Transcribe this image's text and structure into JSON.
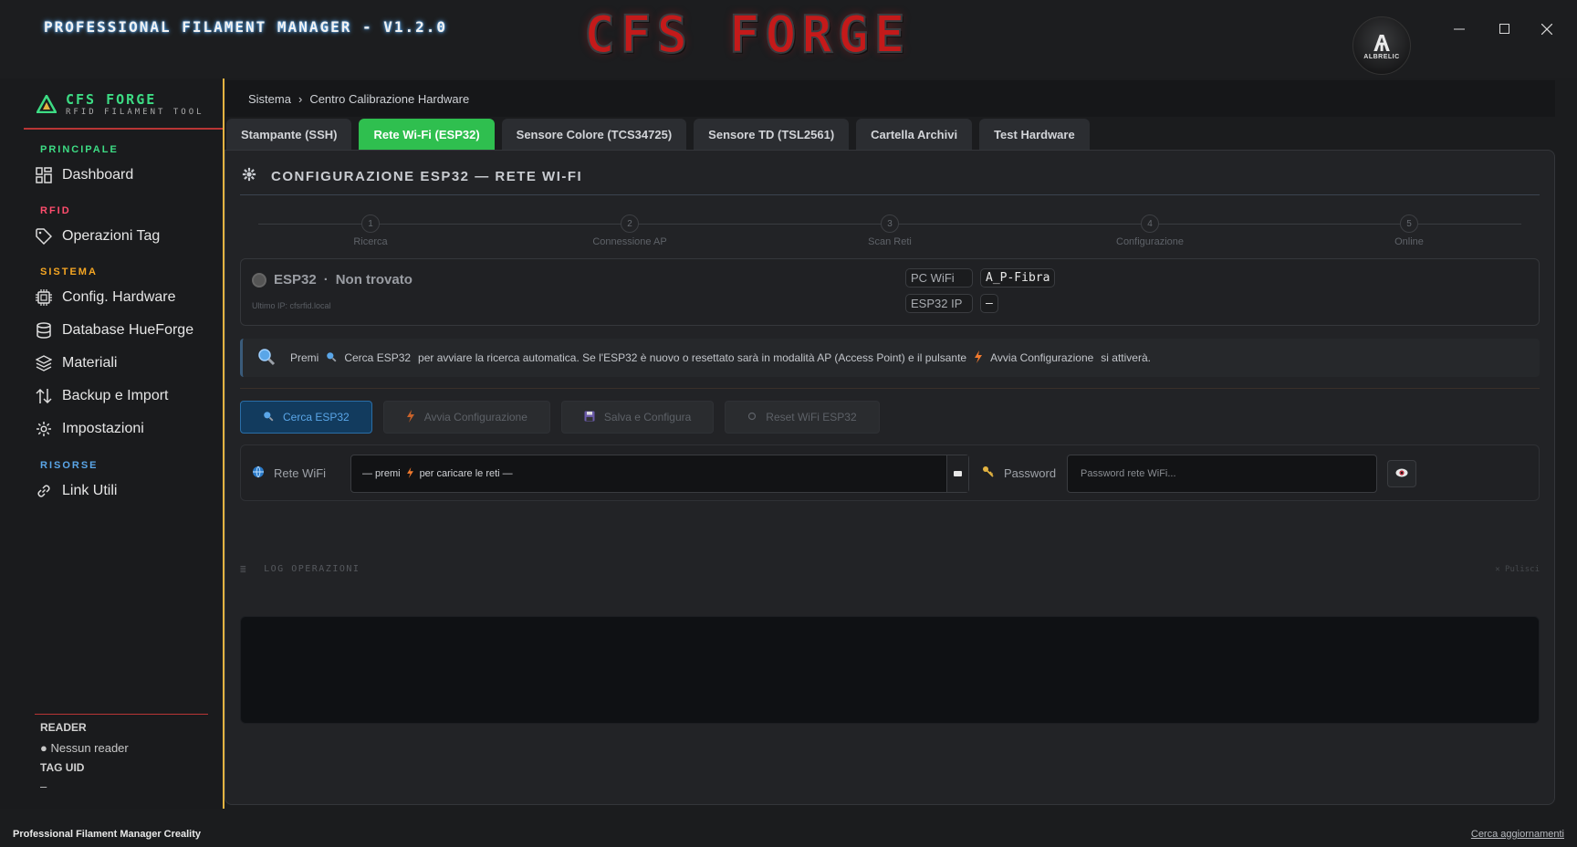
{
  "window": {
    "title": "PROFESSIONAL FILAMENT MANAGER - V1.2.0",
    "brand_logo": "CFS FORGE",
    "avatar_text": "ALBRELIC"
  },
  "sidebar": {
    "brand_name": "CFS FORGE",
    "brand_sub": "RFID FILAMENT TOOL",
    "sections": [
      {
        "label": "PRINCIPALE",
        "color": "#3ddc84"
      },
      {
        "label": "RFID",
        "color": "#ff4d6d"
      },
      {
        "label": "SISTEMA",
        "color": "#f5a623"
      },
      {
        "label": "RISORSE",
        "color": "#5aa6e8"
      }
    ],
    "items": [
      {
        "label": "Dashboard",
        "icon": "grid-icon"
      },
      {
        "label": "Operazioni Tag",
        "icon": "tag-icon"
      },
      {
        "label": "Config. Hardware",
        "icon": "chip-icon"
      },
      {
        "label": "Database HueForge",
        "icon": "database-icon"
      },
      {
        "label": "Materiali",
        "icon": "layers-icon"
      },
      {
        "label": "Backup e Import",
        "icon": "transfer-icon"
      },
      {
        "label": "Impostazioni",
        "icon": "gear-icon"
      },
      {
        "label": "Link Utili",
        "icon": "link-icon"
      }
    ],
    "reader_label": "READER",
    "reader_value": "Nessun reader",
    "tag_uid_label": "TAG UID",
    "tag_uid_value": "–"
  },
  "breadcrumb": {
    "root": "Sistema",
    "separator": "›",
    "current": "Centro Calibrazione Hardware"
  },
  "tabs": [
    {
      "label": "Stampante (SSH)",
      "active": false
    },
    {
      "label": "Rete Wi-Fi (ESP32)",
      "active": true
    },
    {
      "label": "Sensore Colore (TCS34725)",
      "active": false
    },
    {
      "label": "Sensore TD (TSL2561)",
      "active": false
    },
    {
      "label": "Cartella Archivi",
      "active": false
    },
    {
      "label": "Test Hardware",
      "active": false
    }
  ],
  "panel": {
    "title": "CONFIGURAZIONE ESP32 — RETE WI-FI",
    "steps": [
      {
        "num": "1",
        "label": "Ricerca"
      },
      {
        "num": "2",
        "label": "Connessione AP"
      },
      {
        "num": "3",
        "label": "Scan Reti"
      },
      {
        "num": "4",
        "label": "Configurazione"
      },
      {
        "num": "5",
        "label": "Online"
      }
    ],
    "esp_name": "ESP32",
    "esp_dot": "·",
    "esp_status": "Non trovato",
    "esp_last_ip": "Ultimo IP: cfsrfid.local",
    "pc_wifi_label": "PC WiFi",
    "pc_wifi_value": "A_P-Fibra",
    "esp_ip_label": "ESP32 IP",
    "esp_ip_value": "–",
    "hint": {
      "prefix": "Premi",
      "search_label": "Cerca ESP32",
      "middle": "per avviare la ricerca automatica. Se l'ESP32 è nuovo o resettato sarà in modalità AP (Access Point) e il pulsante",
      "config_label": "Avvia Configurazione",
      "suffix": "si attiverà."
    },
    "buttons": {
      "search": "Cerca ESP32",
      "start_config": "Avvia Configurazione",
      "save_config": "Salva e Configura",
      "reset_wifi": "Reset WiFi ESP32"
    },
    "wifi_label": "Rete WiFi",
    "wifi_select_prefix": "— premi",
    "wifi_select_suffix": "per caricare le reti —",
    "password_label": "Password",
    "password_placeholder": "Password rete WiFi...",
    "log_title": "LOG OPERAZIONI",
    "log_clear": "✕ Pulisci"
  },
  "statusbar": {
    "left": "Professional Filament Manager Creality",
    "right": "Cerca aggiornamenti"
  },
  "colors": {
    "accent_green": "#2fbf4f",
    "sidebar_border": "#e3b341",
    "primary_blue": "#5aa6e8"
  }
}
